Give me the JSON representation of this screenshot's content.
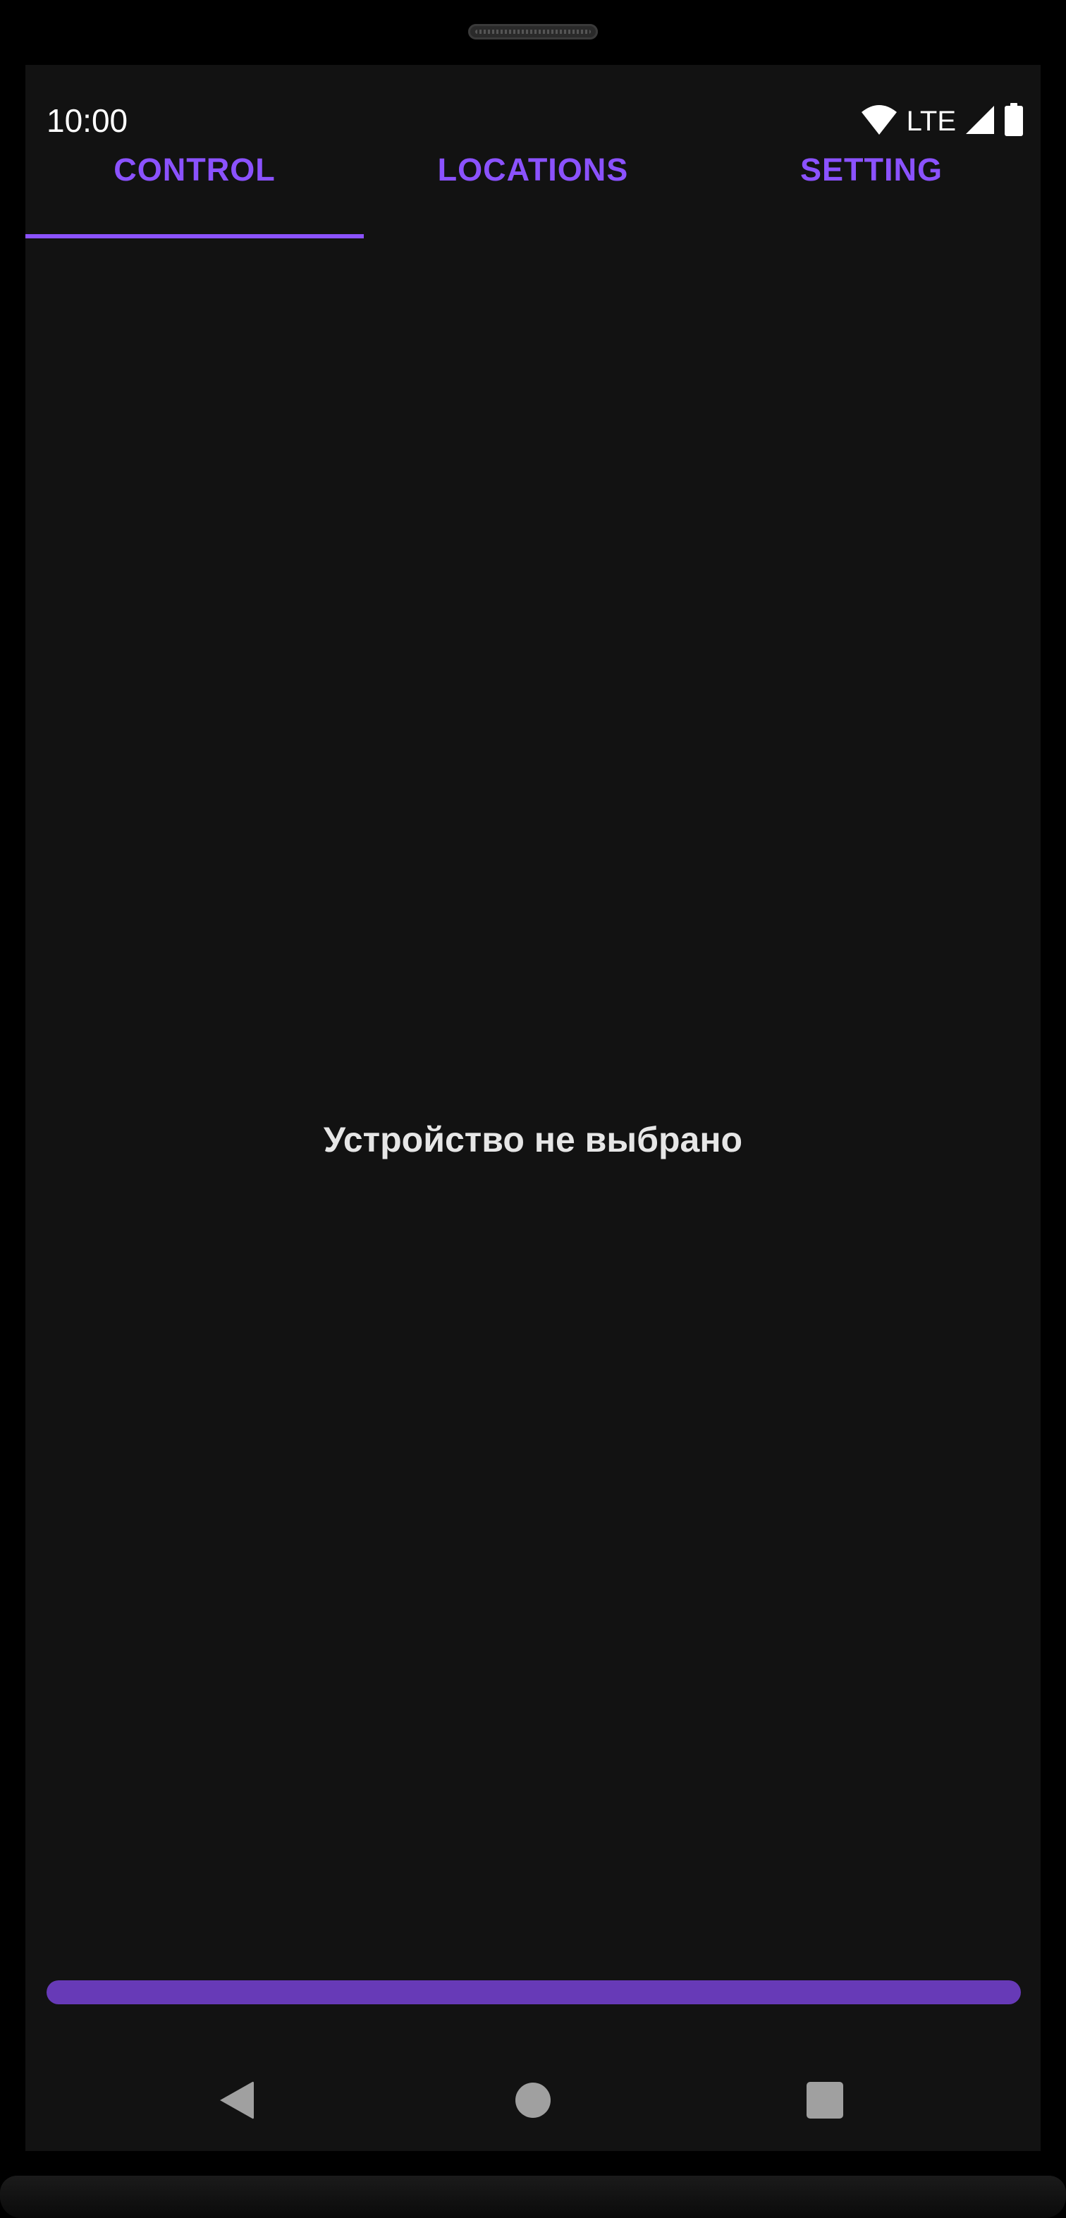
{
  "status_bar": {
    "time": "10:00",
    "network": "LTE",
    "icons": [
      "wifi-icon",
      "signal-icon",
      "battery-icon"
    ]
  },
  "tabs": [
    {
      "label": "CONTROL",
      "selected": true
    },
    {
      "label": "LOCATIONS",
      "selected": false
    },
    {
      "label": "SETTING",
      "selected": false
    }
  ],
  "main": {
    "message": "Устройство не выбрано"
  },
  "progress": {
    "value": 1.0
  },
  "navigation": {
    "icons": [
      "back-icon",
      "home-icon",
      "recents-icon"
    ]
  },
  "colors": {
    "accent": "#8b52ff",
    "progress": "#673ab7",
    "background": "#121212",
    "text": "#e6e6e6"
  }
}
